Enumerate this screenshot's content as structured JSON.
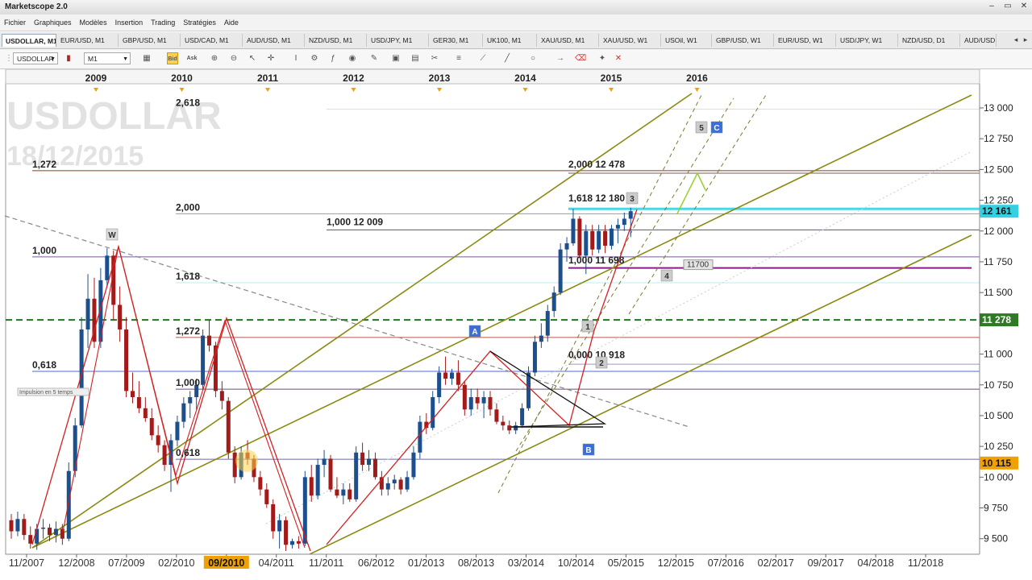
{
  "app": {
    "title": "Marketscope 2.0"
  },
  "window_controls": {
    "minimize": "–",
    "restore": "▭",
    "close": "✕"
  },
  "menu": [
    "Fichier",
    "Graphiques",
    "Modèles",
    "Insertion",
    "Trading",
    "Stratégies",
    "Aide"
  ],
  "tabs": [
    {
      "label": "USDOLLAR, M1",
      "active": true
    },
    {
      "label": "EUR/USD, M1"
    },
    {
      "label": "GBP/USD, M1"
    },
    {
      "label": "USD/CAD, M1"
    },
    {
      "label": "AUD/USD, M1"
    },
    {
      "label": "NZD/USD, M1"
    },
    {
      "label": "USD/JPY, M1"
    },
    {
      "label": "GER30, M1"
    },
    {
      "label": "UK100, M1"
    },
    {
      "label": "XAU/USD, M1"
    },
    {
      "label": "XAU/USD, W1"
    },
    {
      "label": "USOil, W1"
    },
    {
      "label": "GBP/USD, W1"
    },
    {
      "label": "EUR/USD, W1"
    },
    {
      "label": "USD/JPY, W1"
    },
    {
      "label": "NZD/USD, D1"
    },
    {
      "label": "AUD/USD,"
    }
  ],
  "toolbar": {
    "instrument": "USDOLLAR",
    "timeframe": "M1",
    "bid_label": "Bid",
    "ask_label": "Ask"
  },
  "colors": {
    "up_candle": "#1c4f8e",
    "down_candle": "#a31a1a",
    "channel": "#8a8a12",
    "support": "#1a7a1a",
    "wave": "#d32020",
    "fib_cyan": "#4ad8e8",
    "price_tag_cyan": "#35d0e0",
    "price_tag_green": "#2f7a24",
    "price_tag_orange": "#f0a000"
  },
  "chart_data": {
    "type": "candlestick",
    "watermark_symbol": "USDOLLAR",
    "watermark_date": "18/12/2015",
    "top_axis_years": [
      "2009",
      "2010",
      "2011",
      "2012",
      "2013",
      "2014",
      "2015",
      "2016"
    ],
    "x_tick_labels": [
      "11/2007",
      "12/2008",
      "07/2009",
      "02/2010",
      "09/2010",
      "04/2011",
      "11/2011",
      "06/2012",
      "01/2013",
      "08/2013",
      "03/2014",
      "10/2014",
      "05/2015",
      "12/2015",
      "07/2016",
      "02/2017",
      "09/2017",
      "04/2018",
      "11/2018"
    ],
    "highlighted_x_label": "09/2010",
    "y_tick_labels": [
      "13 000",
      "12 750",
      "12 500",
      "12 250",
      "12 000",
      "11 750",
      "11 500",
      "11 000",
      "10 750",
      "10 500",
      "10 250",
      "10 000",
      "9 750",
      "9 500"
    ],
    "y_range": [
      9400,
      13100
    ],
    "price_tags": [
      {
        "label": "12 161",
        "value": 12161,
        "color": "cyan"
      },
      {
        "label": "11 278",
        "value": 11278,
        "color": "green"
      },
      {
        "label": "10 115",
        "value": 10115,
        "color": "orange"
      }
    ],
    "fib_labels_left": [
      {
        "label": "2,618",
        "value": 12990
      },
      {
        "label": "1,272",
        "value": 12490
      },
      {
        "label": "2,000",
        "value": 12140
      },
      {
        "label": "1,000",
        "value": 11790
      },
      {
        "label": "1,618",
        "value": 11580
      },
      {
        "label": "1,272",
        "value": 11135
      },
      {
        "label": "0,618",
        "value": 10860
      },
      {
        "label": "1,000",
        "value": 10715
      },
      {
        "label": "0,618",
        "value": 10145
      }
    ],
    "fib_labels_right": [
      {
        "label": "2,000 12 478",
        "value": 12478
      },
      {
        "label": "1,618 12 180",
        "value": 12180
      },
      {
        "label": "1,000 12 009",
        "value": 12009
      },
      {
        "label": "1,000 11 698",
        "value": 11698
      },
      {
        "label": "0,000 10 918",
        "value": 10918
      }
    ],
    "level_label": "11700",
    "wave_labels": [
      "W",
      "A",
      "B",
      "C",
      "1",
      "2",
      "3",
      "4",
      "5"
    ],
    "annotation": "Impulsion en 5 temps",
    "candles": [
      {
        "t": "11/2007",
        "o": 9650,
        "h": 9700,
        "l": 9500,
        "c": 9560
      },
      {
        "t": "12/2007",
        "o": 9560,
        "h": 9720,
        "l": 9520,
        "c": 9660
      },
      {
        "t": "01/2008",
        "o": 9660,
        "h": 9700,
        "l": 9490,
        "c": 9530
      },
      {
        "t": "02/2008",
        "o": 9530,
        "h": 9600,
        "l": 9420,
        "c": 9460
      },
      {
        "t": "03/2008",
        "o": 9460,
        "h": 9620,
        "l": 9410,
        "c": 9580
      },
      {
        "t": "04/2008",
        "o": 9580,
        "h": 9660,
        "l": 9500,
        "c": 9590
      },
      {
        "t": "05/2008",
        "o": 9590,
        "h": 9620,
        "l": 9480,
        "c": 9530
      },
      {
        "t": "06/2008",
        "o": 9530,
        "h": 9640,
        "l": 9470,
        "c": 9580
      },
      {
        "t": "07/2008",
        "o": 9580,
        "h": 9620,
        "l": 9450,
        "c": 9500
      },
      {
        "t": "08/2008",
        "o": 9500,
        "h": 10120,
        "l": 9480,
        "c": 10050
      },
      {
        "t": "09/2008",
        "o": 10050,
        "h": 10480,
        "l": 10000,
        "c": 10420
      },
      {
        "t": "10/2008",
        "o": 10420,
        "h": 11300,
        "l": 10400,
        "c": 11200
      },
      {
        "t": "11/2008",
        "o": 11200,
        "h": 11650,
        "l": 11050,
        "c": 11450
      },
      {
        "t": "12/2008",
        "o": 11450,
        "h": 11620,
        "l": 11050,
        "c": 11100
      },
      {
        "t": "01/2009",
        "o": 11100,
        "h": 11700,
        "l": 11050,
        "c": 11600
      },
      {
        "t": "02/2009",
        "o": 11600,
        "h": 11860,
        "l": 11550,
        "c": 11800
      },
      {
        "t": "03/2009",
        "o": 11800,
        "h": 11840,
        "l": 11280,
        "c": 11400
      },
      {
        "t": "04/2009",
        "o": 11400,
        "h": 11550,
        "l": 11100,
        "c": 11200
      },
      {
        "t": "05/2009",
        "o": 11200,
        "h": 11300,
        "l": 10650,
        "c": 10700
      },
      {
        "t": "06/2009",
        "o": 10700,
        "h": 10850,
        "l": 10600,
        "c": 10650
      },
      {
        "t": "07/2009",
        "o": 10650,
        "h": 10780,
        "l": 10520,
        "c": 10560
      },
      {
        "t": "08/2009",
        "o": 10560,
        "h": 10650,
        "l": 10450,
        "c": 10480
      },
      {
        "t": "09/2009",
        "o": 10480,
        "h": 10560,
        "l": 10300,
        "c": 10340
      },
      {
        "t": "10/2009",
        "o": 10340,
        "h": 10420,
        "l": 10200,
        "c": 10260
      },
      {
        "t": "11/2009",
        "o": 10260,
        "h": 10300,
        "l": 10050,
        "c": 10100
      },
      {
        "t": "12/2009",
        "o": 10100,
        "h": 10350,
        "l": 9880,
        "c": 10300
      },
      {
        "t": "01/2010",
        "o": 10300,
        "h": 10500,
        "l": 10250,
        "c": 10450
      },
      {
        "t": "02/2010",
        "o": 10450,
        "h": 10650,
        "l": 10400,
        "c": 10600
      },
      {
        "t": "03/2010",
        "o": 10600,
        "h": 10700,
        "l": 10480,
        "c": 10650
      },
      {
        "t": "04/2010",
        "o": 10650,
        "h": 10800,
        "l": 10550,
        "c": 10750
      },
      {
        "t": "05/2010",
        "o": 10750,
        "h": 11200,
        "l": 10700,
        "c": 11150
      },
      {
        "t": "06/2010",
        "o": 11150,
        "h": 11280,
        "l": 11020,
        "c": 11070
      },
      {
        "t": "07/2010",
        "o": 11070,
        "h": 11100,
        "l": 10650,
        "c": 10700
      },
      {
        "t": "08/2010",
        "o": 10700,
        "h": 10780,
        "l": 10550,
        "c": 10620
      },
      {
        "t": "09/2010",
        "o": 10620,
        "h": 10650,
        "l": 10150,
        "c": 10200
      },
      {
        "t": "10/2010",
        "o": 10200,
        "h": 10250,
        "l": 9950,
        "c": 10000
      },
      {
        "t": "11/2010",
        "o": 10000,
        "h": 10250,
        "l": 9980,
        "c": 10200
      },
      {
        "t": "12/2010",
        "o": 10200,
        "h": 10300,
        "l": 10100,
        "c": 10150
      },
      {
        "t": "01/2011",
        "o": 10150,
        "h": 10180,
        "l": 9960,
        "c": 10000
      },
      {
        "t": "02/2011",
        "o": 10000,
        "h": 10050,
        "l": 9850,
        "c": 9900
      },
      {
        "t": "03/2011",
        "o": 9900,
        "h": 9950,
        "l": 9750,
        "c": 9780
      },
      {
        "t": "04/2011",
        "o": 9780,
        "h": 9820,
        "l": 9500,
        "c": 9560
      },
      {
        "t": "05/2011",
        "o": 9560,
        "h": 9700,
        "l": 9420,
        "c": 9650
      },
      {
        "t": "06/2011",
        "o": 9650,
        "h": 9680,
        "l": 9400,
        "c": 9450
      },
      {
        "t": "07/2011",
        "o": 9450,
        "h": 9500,
        "l": 9420,
        "c": 9480
      },
      {
        "t": "08/2011",
        "o": 9480,
        "h": 9520,
        "l": 9420,
        "c": 9460
      },
      {
        "t": "09/2011",
        "o": 9460,
        "h": 10050,
        "l": 9440,
        "c": 10000
      },
      {
        "t": "10/2011",
        "o": 10000,
        "h": 10100,
        "l": 9800,
        "c": 9850
      },
      {
        "t": "11/2011",
        "o": 9850,
        "h": 10150,
        "l": 9820,
        "c": 10100
      },
      {
        "t": "12/2011",
        "o": 10100,
        "h": 10220,
        "l": 10000,
        "c": 10150
      },
      {
        "t": "01/2012",
        "o": 10150,
        "h": 10180,
        "l": 9880,
        "c": 9900
      },
      {
        "t": "02/2012",
        "o": 9900,
        "h": 10000,
        "l": 9830,
        "c": 9850
      },
      {
        "t": "03/2012",
        "o": 9850,
        "h": 9950,
        "l": 9780,
        "c": 9900
      },
      {
        "t": "04/2012",
        "o": 9900,
        "h": 9950,
        "l": 9800,
        "c": 9820
      },
      {
        "t": "05/2012",
        "o": 9820,
        "h": 10250,
        "l": 9800,
        "c": 10200
      },
      {
        "t": "06/2012",
        "o": 10200,
        "h": 10280,
        "l": 10050,
        "c": 10100
      },
      {
        "t": "07/2012",
        "o": 10100,
        "h": 10220,
        "l": 10050,
        "c": 10150
      },
      {
        "t": "08/2012",
        "o": 10150,
        "h": 10200,
        "l": 9980,
        "c": 10000
      },
      {
        "t": "09/2012",
        "o": 10000,
        "h": 10050,
        "l": 9850,
        "c": 9900
      },
      {
        "t": "10/2012",
        "o": 9900,
        "h": 10000,
        "l": 9850,
        "c": 9950
      },
      {
        "t": "11/2012",
        "o": 9950,
        "h": 10020,
        "l": 9900,
        "c": 9980
      },
      {
        "t": "12/2012",
        "o": 9980,
        "h": 10000,
        "l": 9860,
        "c": 9900
      },
      {
        "t": "01/2013",
        "o": 9900,
        "h": 10050,
        "l": 9880,
        "c": 10000
      },
      {
        "t": "02/2013",
        "o": 10000,
        "h": 10250,
        "l": 9980,
        "c": 10200
      },
      {
        "t": "03/2013",
        "o": 10200,
        "h": 10500,
        "l": 10150,
        "c": 10450
      },
      {
        "t": "04/2013",
        "o": 10450,
        "h": 10520,
        "l": 10350,
        "c": 10400
      },
      {
        "t": "05/2013",
        "o": 10400,
        "h": 10700,
        "l": 10380,
        "c": 10650
      },
      {
        "t": "06/2013",
        "o": 10650,
        "h": 10900,
        "l": 10600,
        "c": 10850
      },
      {
        "t": "07/2013",
        "o": 10850,
        "h": 10980,
        "l": 10750,
        "c": 10800
      },
      {
        "t": "08/2013",
        "o": 10800,
        "h": 10880,
        "l": 10750,
        "c": 10850
      },
      {
        "t": "09/2013",
        "o": 10850,
        "h": 10950,
        "l": 10700,
        "c": 10750
      },
      {
        "t": "10/2013",
        "o": 10750,
        "h": 10780,
        "l": 10500,
        "c": 10550
      },
      {
        "t": "11/2013",
        "o": 10550,
        "h": 10720,
        "l": 10500,
        "c": 10650
      },
      {
        "t": "12/2013",
        "o": 10650,
        "h": 10720,
        "l": 10550,
        "c": 10600
      },
      {
        "t": "01/2014",
        "o": 10600,
        "h": 10700,
        "l": 10480,
        "c": 10650
      },
      {
        "t": "02/2014",
        "o": 10650,
        "h": 10700,
        "l": 10500,
        "c": 10550
      },
      {
        "t": "03/2014",
        "o": 10550,
        "h": 10600,
        "l": 10430,
        "c": 10450
      },
      {
        "t": "04/2014",
        "o": 10450,
        "h": 10500,
        "l": 10380,
        "c": 10420
      },
      {
        "t": "05/2014",
        "o": 10420,
        "h": 10460,
        "l": 10350,
        "c": 10380
      },
      {
        "t": "06/2014",
        "o": 10380,
        "h": 10450,
        "l": 10350,
        "c": 10420
      },
      {
        "t": "07/2014",
        "o": 10420,
        "h": 10600,
        "l": 10400,
        "c": 10560
      },
      {
        "t": "08/2014",
        "o": 10560,
        "h": 10900,
        "l": 10540,
        "c": 10850
      },
      {
        "t": "09/2014",
        "o": 10850,
        "h": 11150,
        "l": 10820,
        "c": 11100
      },
      {
        "t": "10/2014",
        "o": 11100,
        "h": 11250,
        "l": 11050,
        "c": 11150
      },
      {
        "t": "11/2014",
        "o": 11150,
        "h": 11400,
        "l": 11100,
        "c": 11350
      },
      {
        "t": "12/2014",
        "o": 11350,
        "h": 11550,
        "l": 11300,
        "c": 11500
      },
      {
        "t": "01/2015",
        "o": 11500,
        "h": 11900,
        "l": 11480,
        "c": 11850
      },
      {
        "t": "02/2015",
        "o": 11850,
        "h": 11950,
        "l": 11750,
        "c": 11900
      },
      {
        "t": "03/2015",
        "o": 11900,
        "h": 12180,
        "l": 11880,
        "c": 12100
      },
      {
        "t": "04/2015",
        "o": 12100,
        "h": 12120,
        "l": 11780,
        "c": 11800
      },
      {
        "t": "05/2015",
        "o": 11800,
        "h": 12050,
        "l": 11650,
        "c": 12000
      },
      {
        "t": "06/2015",
        "o": 12000,
        "h": 12050,
        "l": 11800,
        "c": 11850
      },
      {
        "t": "07/2015",
        "o": 11850,
        "h": 12050,
        "l": 11820,
        "c": 12000
      },
      {
        "t": "08/2015",
        "o": 12000,
        "h": 12050,
        "l": 11820,
        "c": 11880
      },
      {
        "t": "09/2015",
        "o": 11880,
        "h": 12050,
        "l": 11850,
        "c": 12020
      },
      {
        "t": "10/2015",
        "o": 12020,
        "h": 12100,
        "l": 11900,
        "c": 12050
      },
      {
        "t": "11/2015",
        "o": 12050,
        "h": 12150,
        "l": 12000,
        "c": 12100
      },
      {
        "t": "12/2015",
        "o": 12100,
        "h": 12190,
        "l": 11950,
        "c": 12161
      }
    ]
  }
}
